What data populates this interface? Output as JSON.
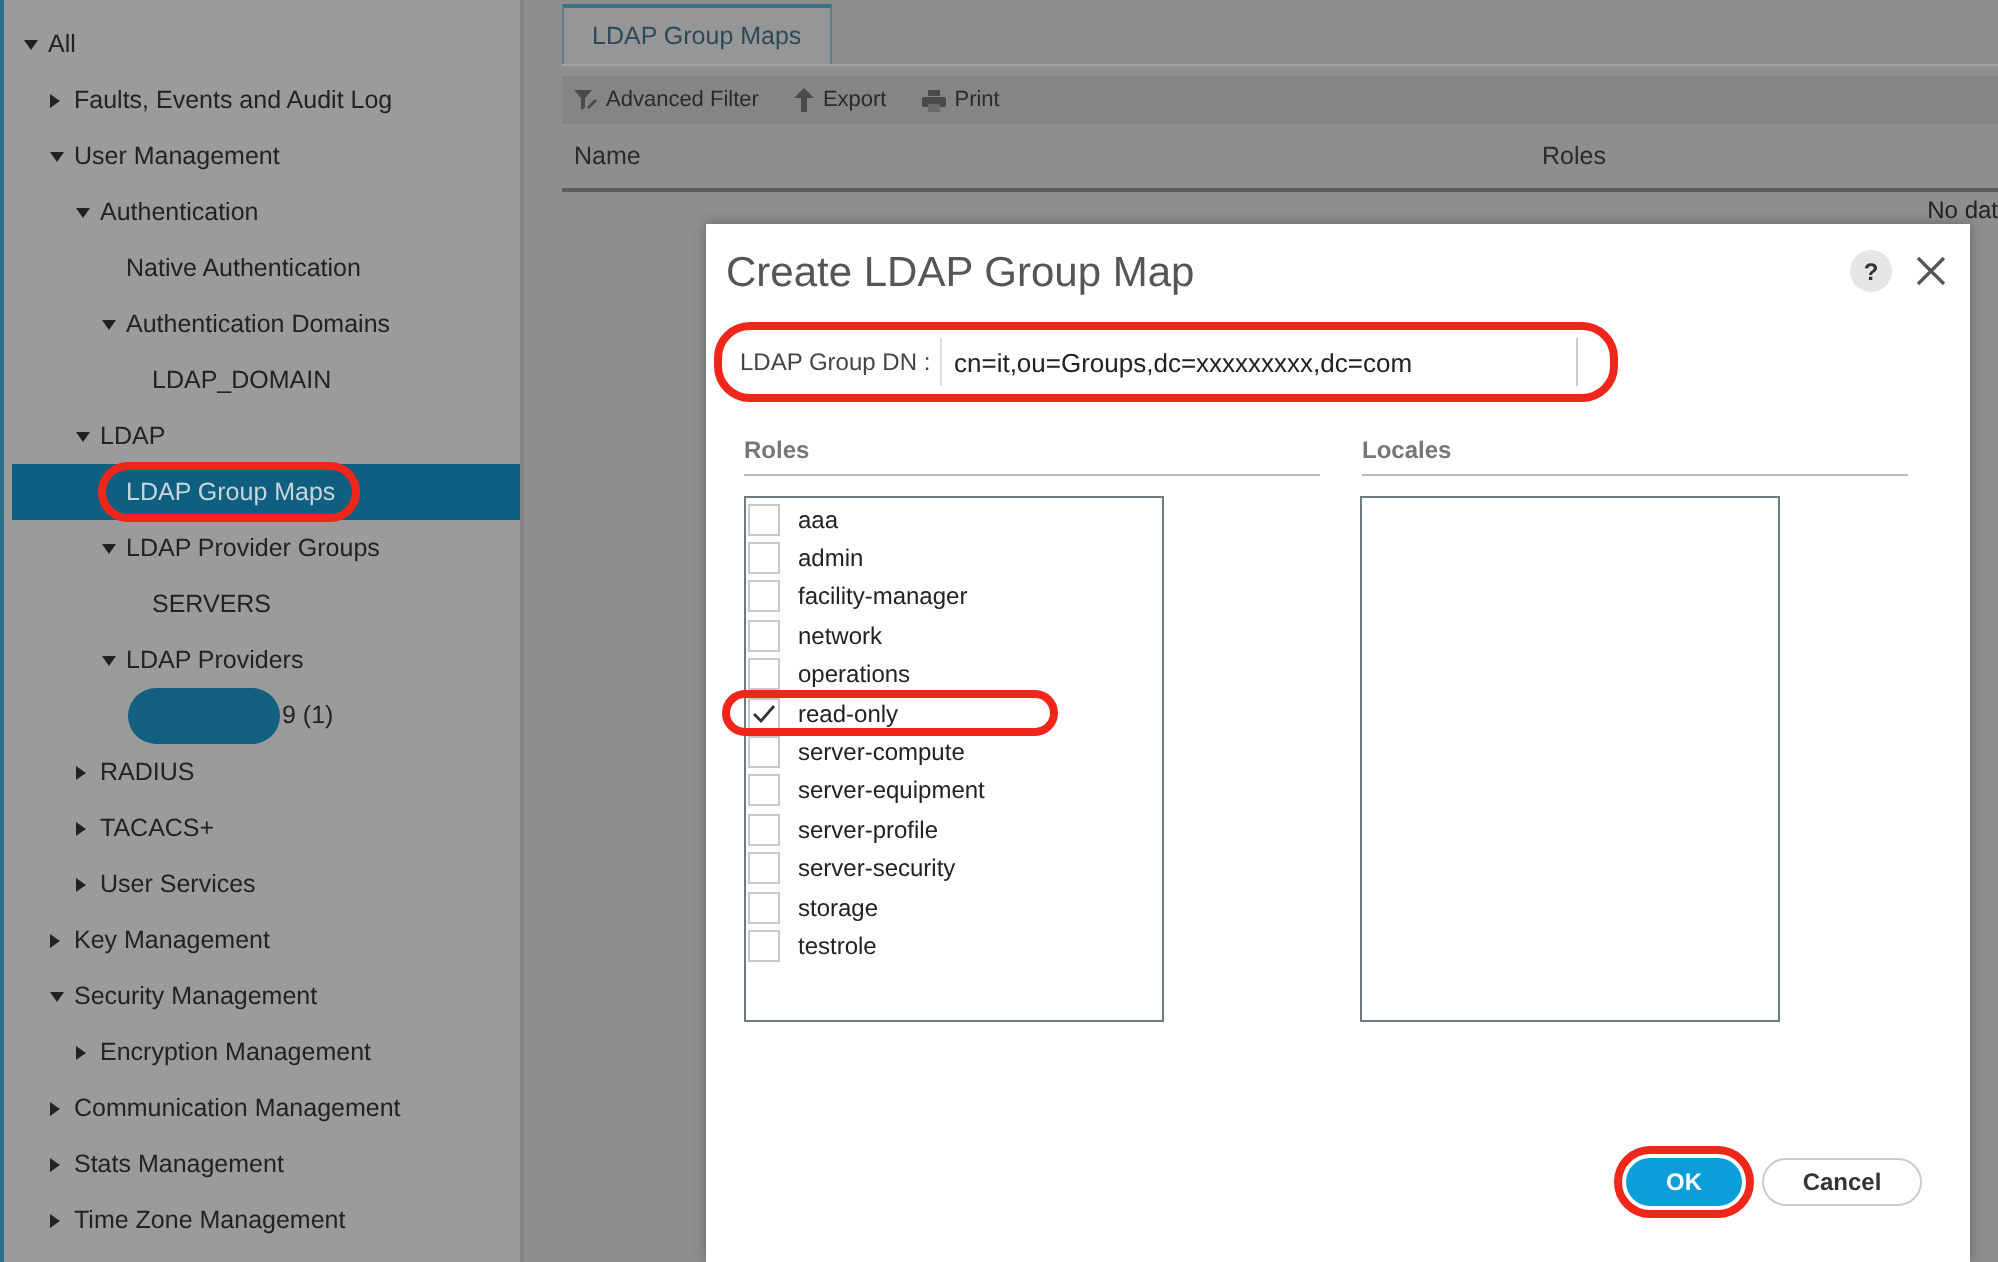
{
  "tree": [
    {
      "label": "All",
      "expanded": true,
      "selected": false,
      "highlighted": false,
      "children": [
        {
          "label": "Faults, Events and Audit Log",
          "expanded": false,
          "selected": false,
          "highlighted": false
        },
        {
          "label": "User Management",
          "expanded": true,
          "selected": false,
          "highlighted": false,
          "children": [
            {
              "label": "Authentication",
              "expanded": true,
              "selected": false,
              "highlighted": false,
              "children": [
                {
                  "label": "Native Authentication",
                  "selected": false,
                  "highlighted": false
                },
                {
                  "label": "Authentication Domains",
                  "expanded": true,
                  "selected": false,
                  "highlighted": false,
                  "children": [
                    {
                      "label": "LDAP_DOMAIN",
                      "selected": false,
                      "highlighted": false
                    }
                  ]
                }
              ]
            },
            {
              "label": "LDAP",
              "expanded": true,
              "selected": false,
              "highlighted": false,
              "children": [
                {
                  "label": "LDAP Group Maps",
                  "selected": true,
                  "highlighted": true
                },
                {
                  "label": "LDAP Provider Groups",
                  "expanded": true,
                  "selected": false,
                  "highlighted": false,
                  "children": [
                    {
                      "label": "SERVERS",
                      "selected": false,
                      "highlighted": false
                    }
                  ]
                },
                {
                  "label": "LDAP Providers",
                  "expanded": true,
                  "selected": false,
                  "highlighted": false,
                  "children": [
                    {
                      "label": "9 (1)",
                      "selected": false,
                      "highlighted": false,
                      "redacted": true
                    }
                  ]
                }
              ]
            },
            {
              "label": "RADIUS",
              "expanded": false,
              "selected": false,
              "highlighted": false
            },
            {
              "label": "TACACS+",
              "expanded": false,
              "selected": false,
              "highlighted": false
            },
            {
              "label": "User Services",
              "expanded": false,
              "selected": false,
              "highlighted": false
            }
          ]
        },
        {
          "label": "Key Management",
          "expanded": false,
          "selected": false,
          "highlighted": false
        },
        {
          "label": "Security Management",
          "expanded": true,
          "selected": false,
          "highlighted": false,
          "children": [
            {
              "label": "Encryption Management",
              "expanded": false,
              "selected": false,
              "highlighted": false
            }
          ]
        },
        {
          "label": "Communication Management",
          "expanded": false,
          "selected": false,
          "highlighted": false
        },
        {
          "label": "Stats Management",
          "expanded": false,
          "selected": false,
          "highlighted": false
        },
        {
          "label": "Time Zone Management",
          "expanded": false,
          "selected": false,
          "highlighted": false
        }
      ]
    }
  ],
  "tabs": [
    {
      "label": "LDAP Group Maps",
      "selected": true
    }
  ],
  "toolbar": [
    "Advanced Filter",
    "Export",
    "Print"
  ],
  "table": {
    "columns": [
      "Name",
      "Roles"
    ],
    "empty_text": "No dat"
  },
  "dialog": {
    "title": "Create LDAP Group Map",
    "dn_field": {
      "label": "LDAP Group DN :",
      "value": "cn=it,ou=Groups,dc=xxxxxxxxx,dc=com",
      "highlighted": true
    },
    "roles_title": "Roles",
    "locales_title": "Locales",
    "roles": [
      {
        "name": "aaa",
        "checked": false,
        "highlighted": false
      },
      {
        "name": "admin",
        "checked": false,
        "highlighted": false
      },
      {
        "name": "facility-manager",
        "checked": false,
        "highlighted": false
      },
      {
        "name": "network",
        "checked": false,
        "highlighted": false
      },
      {
        "name": "operations",
        "checked": false,
        "highlighted": false
      },
      {
        "name": "read-only",
        "checked": true,
        "highlighted": true
      },
      {
        "name": "server-compute",
        "checked": false,
        "highlighted": false
      },
      {
        "name": "server-equipment",
        "checked": false,
        "highlighted": false
      },
      {
        "name": "server-profile",
        "checked": false,
        "highlighted": false
      },
      {
        "name": "server-security",
        "checked": false,
        "highlighted": false
      },
      {
        "name": "storage",
        "checked": false,
        "highlighted": false
      },
      {
        "name": "testrole",
        "checked": false,
        "highlighted": false
      }
    ],
    "help": "?",
    "buttons": [
      {
        "label": "OK",
        "kind": "primary",
        "highlighted": true
      },
      {
        "label": "Cancel",
        "kind": "secondary",
        "highlighted": false
      }
    ]
  }
}
